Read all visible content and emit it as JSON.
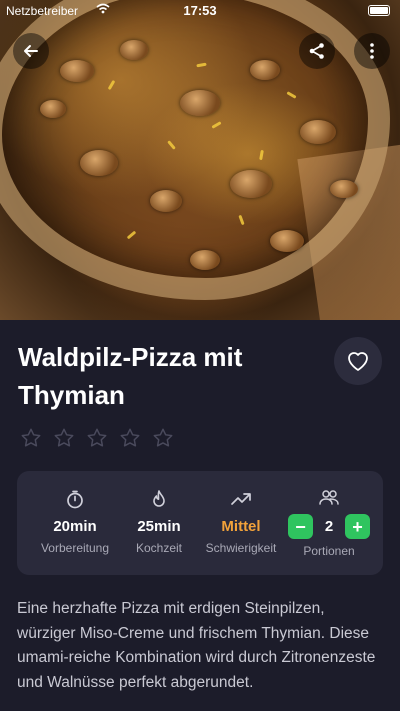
{
  "status_bar": {
    "carrier": "Netzbetreiber",
    "time": "17:53"
  },
  "toolbar": {
    "back_icon": "arrow-left-icon",
    "share_icon": "share-icon",
    "more_icon": "more-vertical-icon"
  },
  "recipe": {
    "title": "Waldpilz-Pizza mit Thymian",
    "rating": {
      "value": 0,
      "max": 5
    },
    "stats": {
      "prep": {
        "value": "20min",
        "label": "Vorbereitung"
      },
      "cook": {
        "value": "25min",
        "label": "Kochzeit"
      },
      "difficulty": {
        "value": "Mittel",
        "label": "Schwierigkeit"
      },
      "portions": {
        "value": "2",
        "label": "Portionen",
        "minus": "−",
        "plus": "+"
      }
    },
    "description": "Eine herzhafte Pizza mit erdigen Steinpilzen, würziger Miso-Creme und frischem Thymian. Diese umami-reiche Kombination wird durch Zitronenzeste und Walnüsse perfekt abgerundet."
  },
  "colors": {
    "background": "#1c1c2a",
    "card": "#2a2a3b",
    "accent_green": "#2fc45f",
    "difficulty_orange": "#f2a23a"
  }
}
